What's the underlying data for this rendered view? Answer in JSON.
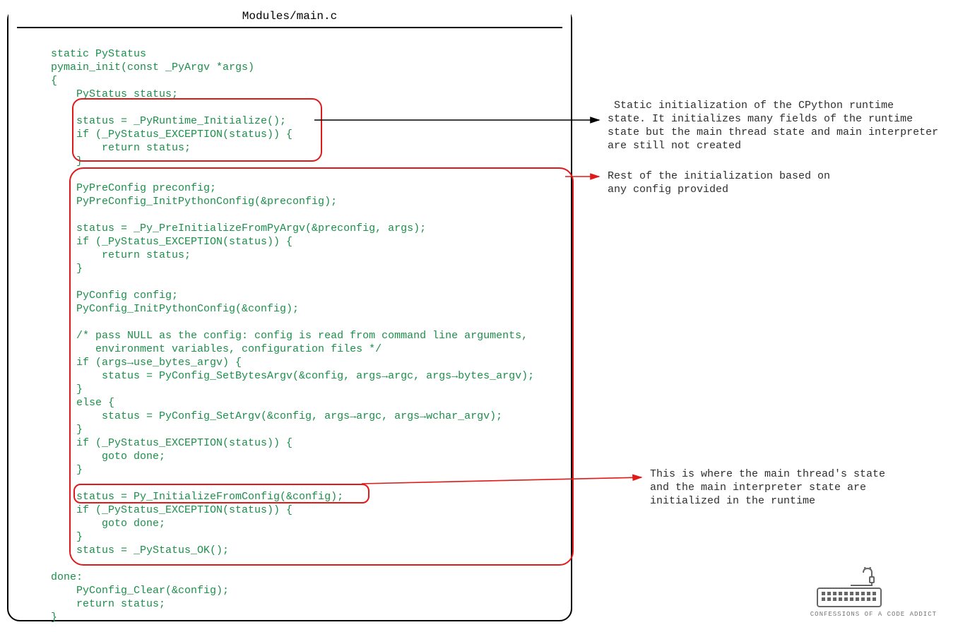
{
  "panel": {
    "title": "Modules/main.c"
  },
  "code": {
    "l0": "static PyStatus",
    "l1": "pymain_init(const _PyArgv *args)",
    "l2": "{",
    "l3": "    PyStatus status;",
    "l4": "",
    "l5": "    status = _PyRuntime_Initialize();",
    "l6": "    if (_PyStatus_EXCEPTION(status)) {",
    "l7": "        return status;",
    "l8": "    }",
    "l9": "",
    "l10": "    PyPreConfig preconfig;",
    "l11": "    PyPreConfig_InitPythonConfig(&preconfig);",
    "l12": "",
    "l13": "    status = _Py_PreInitializeFromPyArgv(&preconfig, args);",
    "l14": "    if (_PyStatus_EXCEPTION(status)) {",
    "l15": "        return status;",
    "l16": "    }",
    "l17": "",
    "l18": "    PyConfig config;",
    "l19": "    PyConfig_InitPythonConfig(&config);",
    "l20": "",
    "l21": "    /* pass NULL as the config: config is read from command line arguments,",
    "l22": "       environment variables, configuration files */",
    "l23": "    if (args→use_bytes_argv) {",
    "l24": "        status = PyConfig_SetBytesArgv(&config, args→argc, args→bytes_argv);",
    "l25": "    }",
    "l26": "    else {",
    "l27": "        status = PyConfig_SetArgv(&config, args→argc, args→wchar_argv);",
    "l28": "    }",
    "l29": "    if (_PyStatus_EXCEPTION(status)) {",
    "l30": "        goto done;",
    "l31": "    }",
    "l32": "",
    "l33": "    status = Py_InitializeFromConfig(&config);",
    "l34": "    if (_PyStatus_EXCEPTION(status)) {",
    "l35": "        goto done;",
    "l36": "    }",
    "l37": "    status = _PyStatus_OK();",
    "l38": "",
    "l39": "done:",
    "l40": "    PyConfig_Clear(&config);",
    "l41": "    return status;",
    "l42": "}"
  },
  "annotations": {
    "a1": " Static initialization of the CPython runtime\nstate. It initializes many fields of the runtime\nstate but the main thread state and main interpreter\nare still not created",
    "a2": "Rest of the initialization based on\nany config provided",
    "a3": "This is where the main thread's state\nand the main interpreter state are\ninitialized in the runtime"
  },
  "logo": {
    "caption": "CONFESSIONS OF A CODE ADDICT"
  },
  "colors": {
    "code": "#1c8f4a",
    "highlight_border": "#e11919",
    "arrow_black": "#000000",
    "arrow_red": "#e11919"
  }
}
